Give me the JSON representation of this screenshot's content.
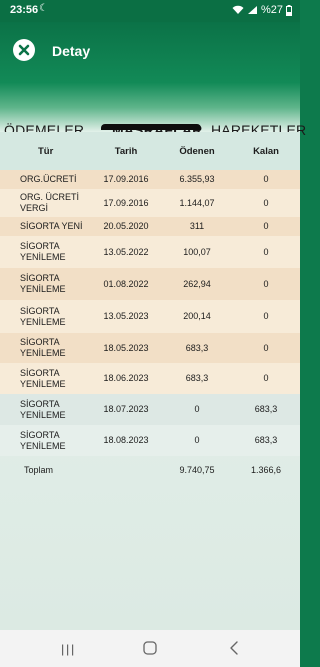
{
  "status": {
    "time": "23:56",
    "battery": "%27"
  },
  "header": {
    "title": "Detay"
  },
  "tabs": [
    {
      "label": "ÖDEMELER",
      "active": false
    },
    {
      "label": "MASRAFLAR",
      "active": true
    },
    {
      "label": "HAREKETLER",
      "active": false
    }
  ],
  "table": {
    "columns": [
      "Tür",
      "Tarih",
      "Ödenen",
      "Kalan"
    ],
    "rows": [
      {
        "type": "ORG.ÜCRETİ",
        "date": "17.09.2016",
        "paid": "6.355,93",
        "remaining": "0"
      },
      {
        "type": "ORG. ÜCRETİ VERGİ",
        "date": "17.09.2016",
        "paid": "1.144,07",
        "remaining": "0"
      },
      {
        "type": "SİGORTA YENİ",
        "date": "20.05.2020",
        "paid": "311",
        "remaining": "0"
      },
      {
        "type": "SİGORTA YENİLEME",
        "date": "13.05.2022",
        "paid": "100,07",
        "remaining": "0"
      },
      {
        "type": "SİGORTA YENİLEME",
        "date": "01.08.2022",
        "paid": "262,94",
        "remaining": "0"
      },
      {
        "type": "SİGORTA YENİLEME",
        "date": "13.05.2023",
        "paid": "200,14",
        "remaining": "0"
      },
      {
        "type": "SİGORTA YENİLEME",
        "date": "18.05.2023",
        "paid": "683,3",
        "remaining": "0"
      },
      {
        "type": "SİGORTA YENİLEME",
        "date": "18.06.2023",
        "paid": "683,3",
        "remaining": "0"
      },
      {
        "type": "SİGORTA YENİLEME",
        "date": "18.07.2023",
        "paid": "0",
        "remaining": "683,3"
      },
      {
        "type": "SİGORTA YENİLEME",
        "date": "18.08.2023",
        "paid": "0",
        "remaining": "683,3"
      }
    ],
    "total": {
      "label": "Toplam",
      "paid": "9.740,75",
      "remaining": "1.366,6"
    }
  },
  "icons": {
    "close": "close-icon",
    "recent": "recent-apps-icon",
    "home": "home-icon",
    "back": "back-icon"
  },
  "colors": {
    "primary": "#0d7a4c",
    "row_paid_a": "#f2dfc6",
    "row_paid_b": "#f7ebd8",
    "row_unpaid": "#dde8e4"
  }
}
